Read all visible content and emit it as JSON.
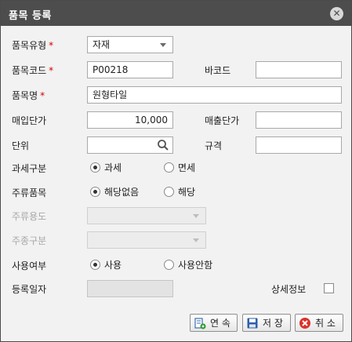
{
  "dialog": {
    "title": "품목 등록",
    "close_glyph": "✕"
  },
  "form": {
    "item_type": {
      "label": "품목유형",
      "required_mark": "*",
      "value": "자재"
    },
    "item_code": {
      "label": "품목코드",
      "required_mark": "*",
      "value": "P00218"
    },
    "barcode": {
      "label": "바코드",
      "value": ""
    },
    "item_name": {
      "label": "품목명",
      "required_mark": "*",
      "value": "원형타일"
    },
    "purchase_price": {
      "label": "매입단가",
      "value": "10,000"
    },
    "sales_price": {
      "label": "매출단가",
      "value": ""
    },
    "unit": {
      "label": "단위",
      "value": ""
    },
    "spec": {
      "label": "규격",
      "value": ""
    },
    "taxation": {
      "label": "과세구분",
      "options": [
        "과세",
        "면세"
      ],
      "selected": "과세"
    },
    "liquor_item": {
      "label": "주류품목",
      "options": [
        "해당없음",
        "해당"
      ],
      "selected": "해당없음"
    },
    "liquor_use": {
      "label": "주류용도",
      "value": ""
    },
    "liquor_kind": {
      "label": "주종구분",
      "value": ""
    },
    "usage": {
      "label": "사용여부",
      "options": [
        "사용",
        "사용안함"
      ],
      "selected": "사용"
    },
    "reg_date": {
      "label": "등록일자",
      "value": ""
    },
    "detail_info": {
      "label": "상세정보",
      "checked": false
    }
  },
  "buttons": {
    "continue": "연 속",
    "save": "저 장",
    "cancel": "취 소"
  },
  "colors": {
    "titlebar": "#4d4d4d",
    "required": "#d40000",
    "cancel_icon": "#d9342b",
    "save_icon": "#2d5fa8"
  }
}
